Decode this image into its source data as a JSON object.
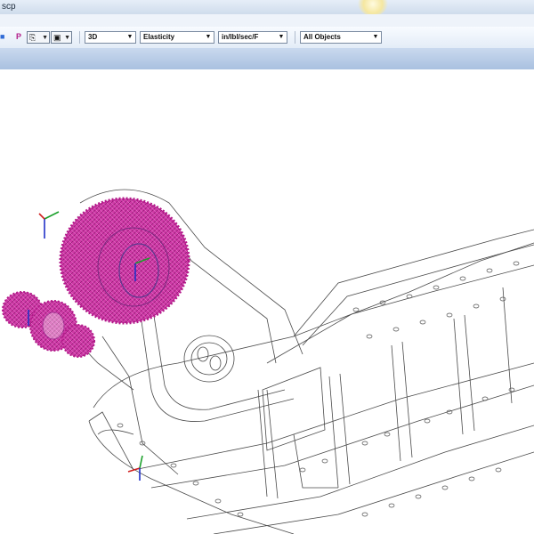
{
  "window": {
    "title": "scp"
  },
  "toolbar": {
    "icons": [
      "cube-icon",
      "p-icon",
      "copy-icon",
      "camera-icon"
    ],
    "p_label": "P",
    "view_mode": "3D",
    "result_type": "Elasticity",
    "units": "in/lbl/sec/F",
    "object_filter": "All Objects"
  },
  "viewport": {
    "content": "wireframe-3d-model",
    "accent_color": "#d0259b",
    "axis_colors": {
      "x": "#d02020",
      "y": "#1aa02a",
      "z": "#2030c8"
    }
  },
  "colors": {
    "toolbar_top": "#f8fbff",
    "toolbar_bottom": "#e3ecf7",
    "band": "#b6cbe6"
  }
}
